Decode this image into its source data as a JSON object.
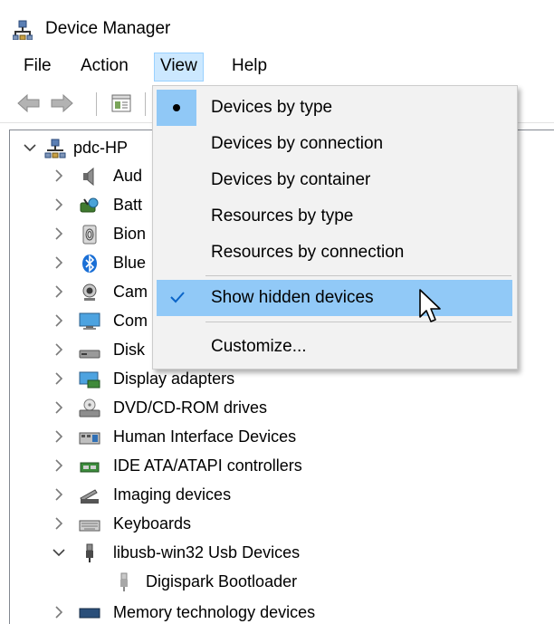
{
  "window": {
    "title": "Device Manager"
  },
  "menubar": {
    "items": [
      "File",
      "Action",
      "View",
      "Help"
    ]
  },
  "toolbar": {
    "buttons": [
      "back-arrow-icon",
      "forward-arrow-icon",
      "properties-icon"
    ]
  },
  "view_menu": {
    "items": [
      {
        "label": "Devices by type",
        "mark": "bullet"
      },
      {
        "label": "Devices by connection",
        "mark": ""
      },
      {
        "label": "Devices by container",
        "mark": ""
      },
      {
        "label": "Resources by type",
        "mark": ""
      },
      {
        "label": "Resources by connection",
        "mark": ""
      },
      {
        "label": "Show hidden devices",
        "mark": "check"
      },
      {
        "label": "Customize...",
        "mark": ""
      }
    ]
  },
  "tree": {
    "root": "pdc-HP",
    "nodes": [
      {
        "label": "Aud",
        "icon": "speaker-icon"
      },
      {
        "label": "Batt",
        "icon": "battery-icon"
      },
      {
        "label": "Bion",
        "icon": "fingerprint-icon"
      },
      {
        "label": "Blue",
        "icon": "bluetooth-icon"
      },
      {
        "label": "Cam",
        "icon": "camera-icon"
      },
      {
        "label": "Com",
        "icon": "computer-icon"
      },
      {
        "label": "Disk",
        "icon": "disk-drive-icon"
      },
      {
        "label": "Display adapters",
        "icon": "display-adapter-icon"
      },
      {
        "label": "DVD/CD-ROM drives",
        "icon": "dvd-drive-icon"
      },
      {
        "label": "Human Interface Devices",
        "icon": "hid-icon"
      },
      {
        "label": "IDE ATA/ATAPI controllers",
        "icon": "ide-controller-icon"
      },
      {
        "label": "Imaging devices",
        "icon": "scanner-icon"
      },
      {
        "label": "Keyboards",
        "icon": "keyboard-icon"
      },
      {
        "label": "libusb-win32 Usb Devices",
        "icon": "usb-icon"
      },
      {
        "label": "Digispark Bootloader",
        "icon": "usb-device-icon"
      },
      {
        "label": "Memory technology devices",
        "icon": "memory-icon"
      }
    ]
  },
  "colors": {
    "menu_open_bg": "#cce8ff",
    "highlight": "#91c9f7",
    "accent_check": "#0a64c8"
  }
}
